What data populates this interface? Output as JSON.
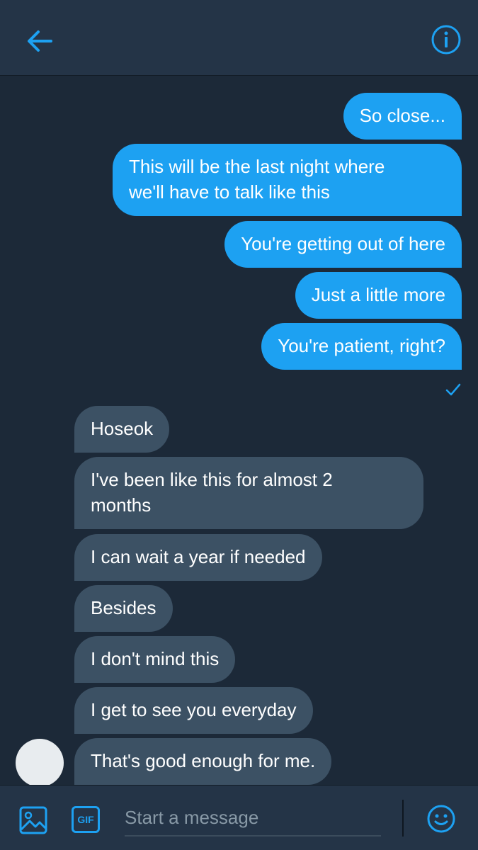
{
  "header": {
    "back_icon": "arrow-left-icon",
    "info_icon": "info-circle-icon"
  },
  "colors": {
    "accent": "#1da1f2",
    "background": "#1c2938",
    "header": "#243447",
    "received_bubble": "#3c5164"
  },
  "messages_sent": [
    "So close...",
    "This will be the last night where",
    "we'll have to talk like this",
    "You're getting out of here",
    "Just a little more",
    "You're patient, right?"
  ],
  "messages_received": [
    "Hoseok",
    "I've been like this for almost 2",
    "months",
    "I can wait a year if needed",
    "Besides",
    "I don't mind this",
    "I get to see you everyday",
    "That's good enough for me."
  ],
  "composer": {
    "placeholder": "Start a message",
    "gif_label": "GIF",
    "image_icon": "image-icon",
    "emoji_icon": "smiley-icon"
  }
}
